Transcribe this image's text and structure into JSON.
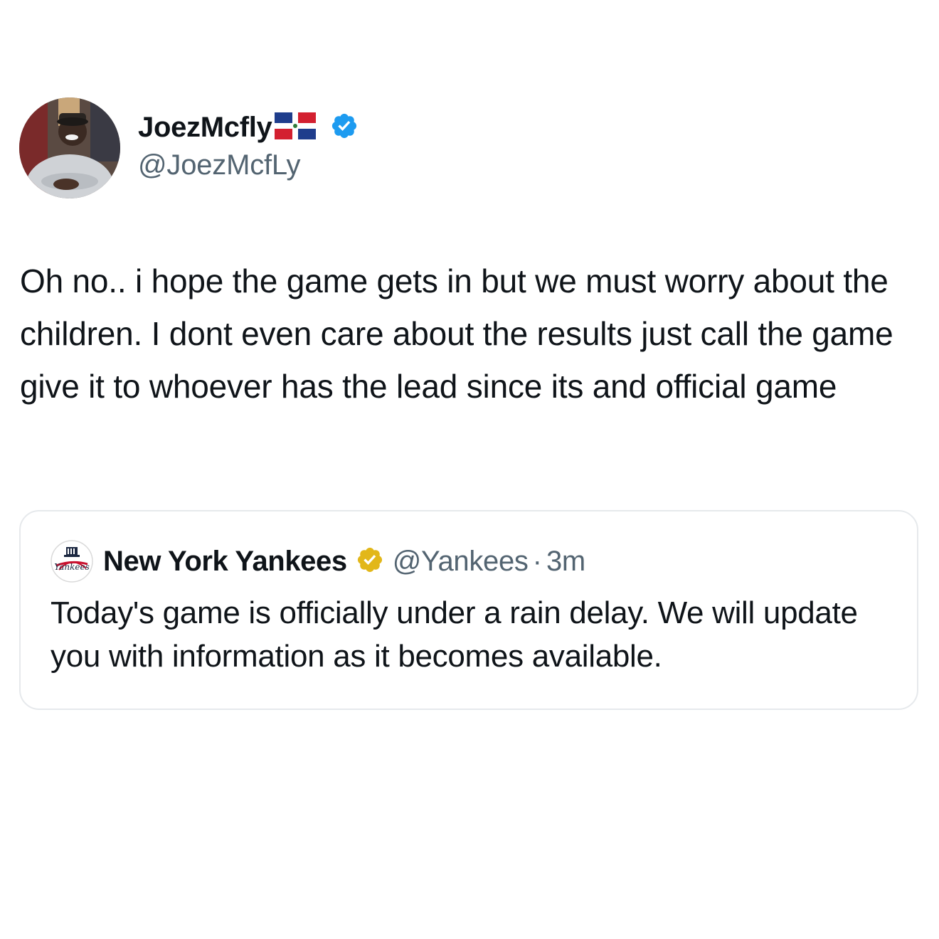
{
  "tweet": {
    "author": {
      "display_name": "JoezMcfly",
      "flag_icon": "dominican-republic-flag-icon",
      "verified_icon": "blue-verified-badge-icon",
      "handle": "@JoezMcfLy"
    },
    "text": "Oh no.. i hope the game gets in but we must worry about the children. I dont even care about the results just call the game give it to whoever has the lead since its and official game",
    "quoted_tweet": {
      "display_name": "New York Yankees",
      "verified_icon": "gold-verified-badge-icon",
      "handle": "@Yankees",
      "separator": "·",
      "timestamp": "3m",
      "text": "Today's game is officially under a rain delay. We will update you with information as it becomes available."
    }
  },
  "colors": {
    "text_primary": "#0f1419",
    "text_secondary": "#536471",
    "verified_blue": "#1d9bf0",
    "verified_gold": "#e2b719",
    "border": "#e6e9ec"
  }
}
